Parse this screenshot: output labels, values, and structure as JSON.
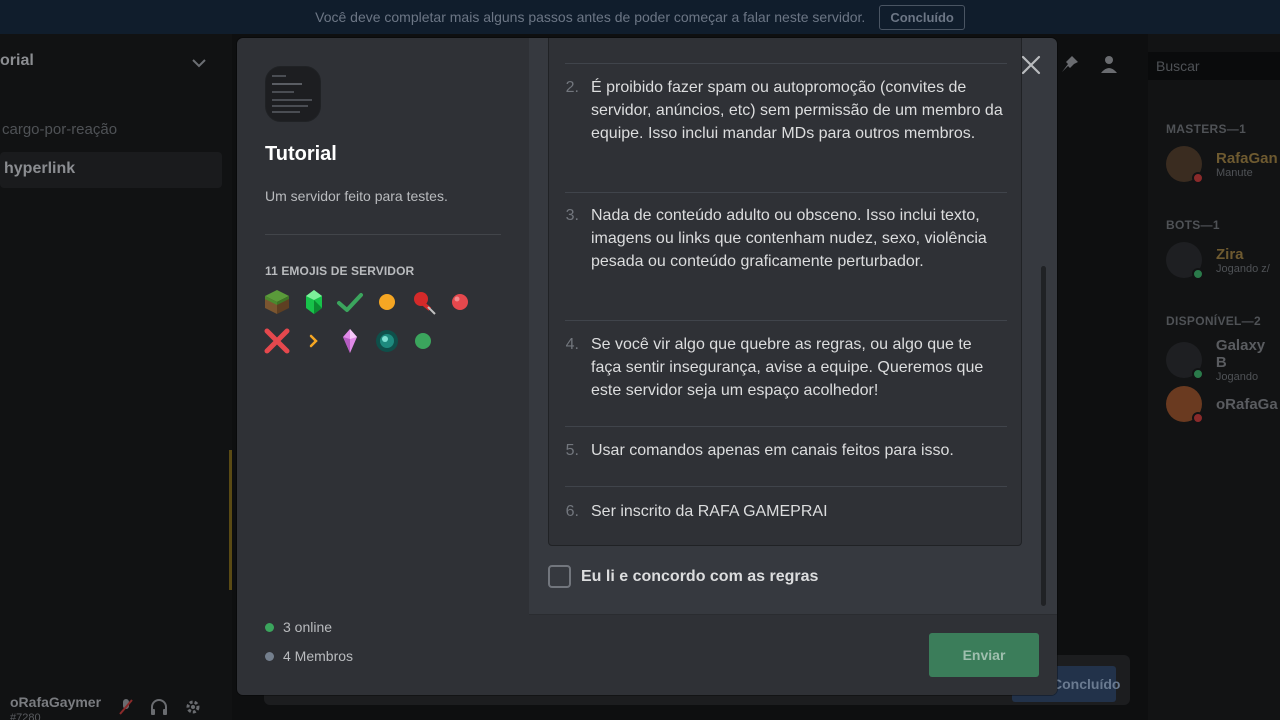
{
  "background": {
    "notice": "Você deve completar mais alguns passos antes de poder começar a falar neste servidor.",
    "notice_button": "Concluído",
    "server_name": "orial",
    "channels": [
      "cargo-por-reação",
      "hyperlink"
    ],
    "user": {
      "name": "oRafaGaymer",
      "tag": "#7280"
    },
    "search_placeholder": "Buscar",
    "member_sections": [
      {
        "label": "MASTERS—1",
        "members": [
          {
            "name": "RafaGan",
            "sub": "Manute"
          }
        ]
      },
      {
        "label": "BOTS—1",
        "members": [
          {
            "name": "Zira",
            "sub": "Jogando z/"
          }
        ]
      },
      {
        "label": "DISPONÍVEL—2",
        "members": [
          {
            "name": "Galaxy B",
            "sub": "Jogando"
          },
          {
            "name": "oRafaGa",
            "sub": ""
          }
        ]
      }
    ],
    "bottom_button": "Concluído"
  },
  "modal": {
    "server_title": "Tutorial",
    "server_description": "Um servidor feito para testes.",
    "emoji_heading": "11 EMOJIS DE SERVIDOR",
    "emojis": [
      "grass-block",
      "emerald",
      "check-mark",
      "orange-circle",
      "red-pushpin",
      "red-circle",
      "red-x",
      "arrow-right",
      "pink-crystal",
      "ender-pearl",
      "green-circle"
    ],
    "online": "3 online",
    "members": "4 Membros",
    "rules": [
      {
        "num": "2.",
        "text": "É proibido fazer spam ou autopromoção (convites de servidor, anúncios, etc) sem permissão de um membro da equipe. Isso inclui mandar MDs para outros membros."
      },
      {
        "num": "3.",
        "text": "Nada de conteúdo adulto ou obsceno. Isso inclui texto, imagens ou links que contenham nudez, sexo, violência pesada ou conteúdo graficamente perturbador."
      },
      {
        "num": "4.",
        "text": "Se você vir algo que quebre as regras, ou algo que te faça sentir insegurança, avise a equipe. Queremos que este servidor seja um espaço acolhedor!"
      },
      {
        "num": "5.",
        "text": "Usar comandos apenas em canais feitos para isso."
      },
      {
        "num": "6.",
        "text": "Ser inscrito da RAFA GAMEPRAI"
      }
    ],
    "agree_label": "Eu li e concordo com as regras",
    "submit_label": "Enviar"
  },
  "colors": {
    "online": "#3ba55d",
    "offline": "#747f8d",
    "submit": "#3b7d5a"
  }
}
